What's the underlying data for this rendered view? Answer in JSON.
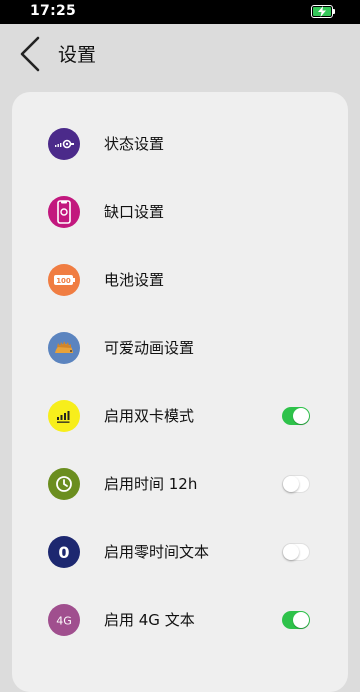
{
  "status_bar": {
    "time": "17:25",
    "battery_color": "#35c759"
  },
  "header": {
    "title": "设置",
    "back_icon": "chevron-left-icon"
  },
  "settings": [
    {
      "label": "状态设置",
      "icon": "status-bars-icon",
      "icon_color": "#4b2a8a"
    },
    {
      "label": "缺口设置",
      "icon": "notch-phone-icon",
      "icon_color": "#c2187e"
    },
    {
      "label": "电池设置",
      "icon": "battery-100-icon",
      "icon_color": "#f07d42",
      "icon_text": "100"
    },
    {
      "label": "可爱动画设置",
      "icon": "hedgehog-icon",
      "icon_color": "#5b84bf"
    },
    {
      "label": "启用双卡模式",
      "icon": "signal-bars-icon",
      "icon_color": "#f7ee1b",
      "toggle": true
    },
    {
      "label": "启用时间 12h",
      "icon": "clock-icon",
      "icon_color": "#6b8e1f",
      "toggle": false
    },
    {
      "label": "启用零时间文本",
      "icon": "zero-icon",
      "icon_color": "#1d2870",
      "icon_text": "0",
      "toggle": false
    },
    {
      "label": "启用 4G 文本",
      "icon": "4g-icon",
      "icon_color": "#a04f8e",
      "icon_text": "4G",
      "toggle": true
    }
  ],
  "toggle_on_color": "#2ec24a"
}
